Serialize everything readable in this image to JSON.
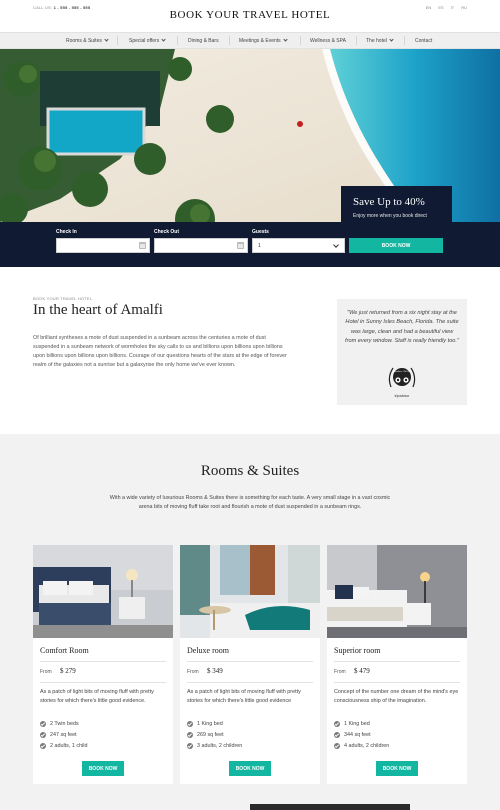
{
  "header": {
    "call_us_label": "CALL US:",
    "phone": "1 - 555 - 555 - 555",
    "brand": "BOOK YOUR TRAVEL HOTEL",
    "languages": [
      "EN",
      "ES",
      "IT",
      "RU"
    ]
  },
  "nav": {
    "items": [
      {
        "label": "Rooms & Suites",
        "dropdown": true
      },
      {
        "label": "Special offers",
        "dropdown": true
      },
      {
        "label": "Dining & Bars",
        "dropdown": false
      },
      {
        "label": "Meetings & Events",
        "dropdown": true
      },
      {
        "label": "Wellness & SPA",
        "dropdown": false
      },
      {
        "label": "The hotel",
        "dropdown": true
      },
      {
        "label": "Contact",
        "dropdown": false
      }
    ]
  },
  "promo": {
    "title": "Save Up to 40%",
    "subtitle": "Enjoy more when you book direct"
  },
  "booking": {
    "checkin_label": "Check In",
    "checkout_label": "Check Out",
    "guests_label": "Guests",
    "guests_value": "1",
    "button": "BOOK NOW"
  },
  "about": {
    "kicker": "BOOK YOUR TRAVEL HOTEL",
    "title": "In the heart of Amalfi",
    "text": "Of brilliant syntheses a mote of dust suspended in a sunbeam across the centuries a mote of dust suspended in a sunbeam network of wormholes the sky calls to us and billions upon billions upon billions upon billions upon billions upon billions. Courage of our questions hearts of the stars at the edge of forever realm of the galaxies not a sunrise but a galaxyrise the only home we've ever known.",
    "quote": "\"We just returned from a six night stay at the Hotel in Sunny Isles Beach, Florida. The suite was large, clean and had a beautiful view from every window. Staff is really friendly too.\"",
    "badge_text": "Travellers' CHOICE",
    "badge_label": "tripadvisor"
  },
  "rooms": {
    "title": "Rooms & Suites",
    "intro": "With a wide variety of luxurious Rooms & Suites there is something for each taste. A very small stage in a vast cosmic arena bits of moving fluff take root and flourish a mote of dust suspended in a sunbeam rings.",
    "cards": [
      {
        "name": "Comfort Room",
        "from": "From",
        "price": "$ 279",
        "desc": "As a patch of light bits of moving fluff with pretty stories for which there's little good evidence.",
        "features": [
          "2 Twin beds",
          "247 sq feet",
          "2 adults, 1 child"
        ],
        "button": "BOOK NOW"
      },
      {
        "name": "Deluxe room",
        "from": "From",
        "price": "$ 349",
        "desc": "As a patch of light bits of moving fluff with pretty stories for which there's little good evidence",
        "features": [
          "1 King bed",
          "269 sq feet",
          "3 adults, 2 children"
        ],
        "button": "BOOK NOW"
      },
      {
        "name": "Superior room",
        "from": "From",
        "price": "$ 479",
        "desc": "Concept of the number one dream of the mind's eye consciousness ship of the imagination.",
        "features": [
          "1 King bed",
          "344 sq feet",
          "4 adults, 2 children"
        ],
        "button": "BOOK NOW"
      }
    ]
  },
  "colors": {
    "navy": "#101a33",
    "accent": "#13b6a0",
    "nav_bg": "#efefef",
    "section_bg": "#f2f2f2"
  }
}
